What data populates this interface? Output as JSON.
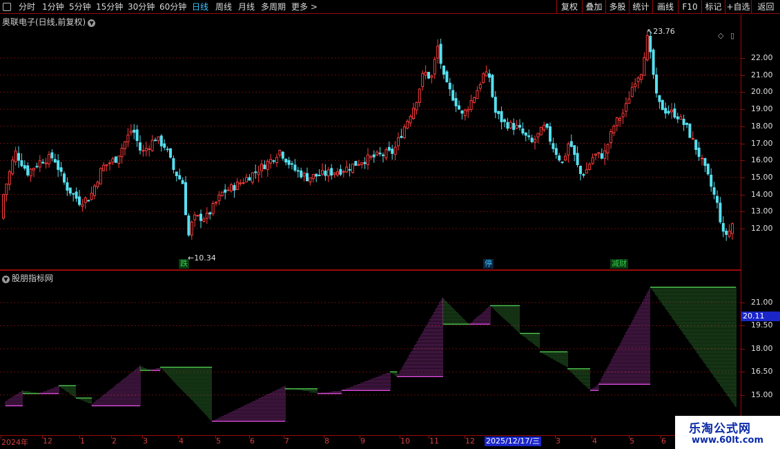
{
  "toolbar": {
    "periods": [
      {
        "label": "分时",
        "active": false
      },
      {
        "label": "1分钟",
        "active": false
      },
      {
        "label": "5分钟",
        "active": false
      },
      {
        "label": "15分钟",
        "active": false
      },
      {
        "label": "30分钟",
        "active": false
      },
      {
        "label": "60分钟",
        "active": false
      },
      {
        "label": "日线",
        "active": true
      },
      {
        "label": "周线",
        "active": false
      },
      {
        "label": "月线",
        "active": false
      },
      {
        "label": "多周期",
        "active": false
      },
      {
        "label": "更多 >",
        "active": false
      }
    ],
    "buttons": [
      "复权",
      "叠加",
      "多股",
      "统计",
      "画线",
      "F10",
      "标记",
      "+自选",
      "返回"
    ]
  },
  "main_chart": {
    "title": "奥联电子(日线,前复权)",
    "high_marker": "23.76",
    "low_marker": "10.34",
    "events": [
      {
        "label": "跌",
        "color": "#2fd14a",
        "bg": "#0a3a12"
      },
      {
        "label": "停",
        "color": "#3cc3ff",
        "bg": "#0a2540"
      },
      {
        "label": "减财",
        "color": "#2fd14a",
        "bg": "#0a3a12"
      }
    ]
  },
  "price_axis": [
    "22.00",
    "21.00",
    "20.00",
    "19.00",
    "18.00",
    "17.00",
    "16.00",
    "15.00",
    "14.00",
    "13.00",
    "12.00"
  ],
  "indicator": {
    "title": "股朋指标网",
    "axis": [
      "21.00",
      "19.50",
      "18.00",
      "16.50",
      "15.00"
    ],
    "current_value": "20.11"
  },
  "date_axis": {
    "labels": [
      "2024年",
      "12",
      "1",
      "2",
      "3",
      "4",
      "5",
      "6",
      "7",
      "8",
      "9",
      "10",
      "11",
      "12",
      "3",
      "4",
      "5",
      "6"
    ],
    "cursor_date": "2025/12/17/三"
  },
  "chart_data": {
    "type": "candlestick",
    "price_range": [
      10.0,
      24.0
    ],
    "high": 23.76,
    "low": 10.34,
    "up_color": "#ff3c3c",
    "down_color": "#56e0f0",
    "grid": true,
    "indicator_colors": {
      "rising": "#d94ad9",
      "falling": "#4ec34e"
    }
  },
  "watermark": {
    "title": "乐淘公式网",
    "url": "www.60lt.com"
  }
}
